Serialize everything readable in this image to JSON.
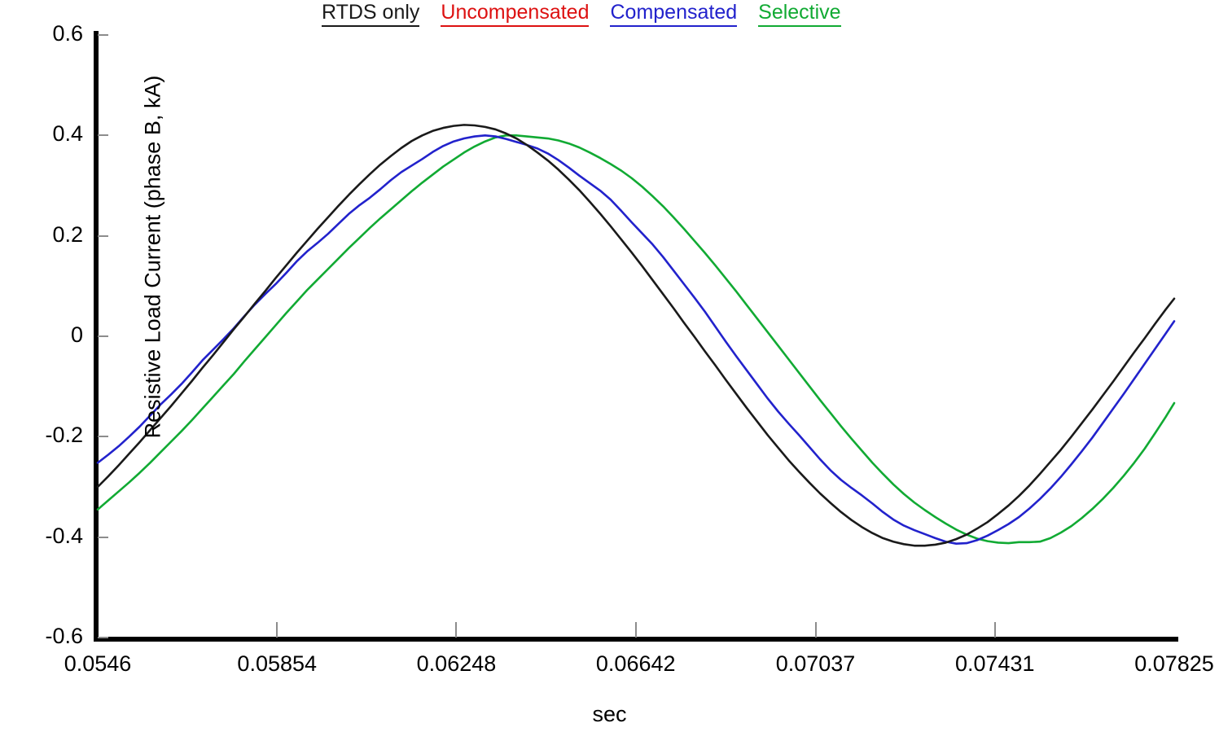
{
  "legend": {
    "entries": [
      {
        "label": "RTDS only",
        "color": "#1a1a1a"
      },
      {
        "label": "Uncompensated",
        "color": "#dd1111"
      },
      {
        "label": "Compensated",
        "color": "#2222cc"
      },
      {
        "label": "Selective",
        "color": "#11aa33"
      }
    ]
  },
  "chart_data": {
    "type": "line",
    "title": "",
    "xlabel": "sec",
    "ylabel": "Resistive Load Current (phase B, kA)",
    "xlim": [
      0.0546,
      0.07825
    ],
    "ylim": [
      -0.6,
      0.6
    ],
    "grid": false,
    "legend_position": "top",
    "xticks": [
      "0.0546",
      "0.05854",
      "0.06248",
      "0.06642",
      "0.07037",
      "0.07431",
      "0.07825"
    ],
    "xtick_values": [
      0.0546,
      0.05854,
      0.06248,
      0.06642,
      0.07037,
      0.07431,
      0.07825
    ],
    "yticks": [
      "0.6",
      "0.4",
      "0.2",
      "0",
      "-0.2",
      "-0.4",
      "-0.6"
    ],
    "ytick_values": [
      0.6,
      0.4,
      0.2,
      0,
      -0.2,
      -0.4,
      -0.6
    ],
    "series": [
      {
        "name": "RTDS only",
        "color": "#1a1a1a",
        "x": [
          0.0546,
          0.05483,
          0.05506,
          0.05529,
          0.05552,
          0.05575,
          0.05598,
          0.05621,
          0.05644,
          0.05667,
          0.0569,
          0.05713,
          0.05736,
          0.05759,
          0.05782,
          0.05805,
          0.05828,
          0.05851,
          0.05874,
          0.05897,
          0.0592,
          0.05943,
          0.05966,
          0.05989,
          0.06012,
          0.06035,
          0.06058,
          0.06081,
          0.06104,
          0.06127,
          0.0615,
          0.06173,
          0.06196,
          0.06219,
          0.06242,
          0.06265,
          0.06288,
          0.06311,
          0.06334,
          0.06357,
          0.0638,
          0.06403,
          0.06426,
          0.06449,
          0.06472,
          0.06495,
          0.06518,
          0.06541,
          0.06564,
          0.06587,
          0.0661,
          0.06633,
          0.06656,
          0.06679,
          0.06702,
          0.06725,
          0.06748,
          0.06771,
          0.06794,
          0.06817,
          0.0684,
          0.06863,
          0.06886,
          0.06909,
          0.06932,
          0.06955,
          0.06978,
          0.07001,
          0.07024,
          0.07047,
          0.0707,
          0.07093,
          0.07116,
          0.07139,
          0.07162,
          0.07185,
          0.07208,
          0.07231,
          0.07254,
          0.07277,
          0.073,
          0.07323,
          0.07346,
          0.07369,
          0.07392,
          0.07415,
          0.07438,
          0.07461,
          0.07484,
          0.07507,
          0.0753,
          0.07553,
          0.07576,
          0.07599,
          0.07622,
          0.07645,
          0.07668,
          0.07691,
          0.07714,
          0.07737,
          0.0776,
          0.07783,
          0.07806,
          0.07825
        ],
        "y": [
          -0.3,
          -0.279,
          -0.257,
          -0.234,
          -0.211,
          -0.187,
          -0.163,
          -0.139,
          -0.114,
          -0.089,
          -0.063,
          -0.038,
          -0.012,
          0.014,
          0.039,
          0.065,
          0.09,
          0.116,
          0.141,
          0.166,
          0.19,
          0.214,
          0.237,
          0.26,
          0.282,
          0.303,
          0.323,
          0.342,
          0.359,
          0.375,
          0.389,
          0.4,
          0.409,
          0.415,
          0.419,
          0.421,
          0.42,
          0.417,
          0.412,
          0.404,
          0.394,
          0.381,
          0.366,
          0.35,
          0.332,
          0.312,
          0.291,
          0.268,
          0.244,
          0.219,
          0.193,
          0.167,
          0.14,
          0.112,
          0.084,
          0.056,
          0.027,
          -0.001,
          -0.03,
          -0.058,
          -0.087,
          -0.115,
          -0.143,
          -0.17,
          -0.197,
          -0.222,
          -0.247,
          -0.27,
          -0.292,
          -0.313,
          -0.332,
          -0.35,
          -0.366,
          -0.38,
          -0.392,
          -0.402,
          -0.409,
          -0.414,
          -0.417,
          -0.417,
          -0.415,
          -0.411,
          -0.404,
          -0.395,
          -0.383,
          -0.37,
          -0.354,
          -0.337,
          -0.318,
          -0.297,
          -0.274,
          -0.25,
          -0.226,
          -0.2,
          -0.173,
          -0.146,
          -0.118,
          -0.09,
          -0.061,
          -0.032,
          -0.004,
          0.025,
          0.053,
          0.075
        ]
      },
      {
        "name": "Compensated",
        "color": "#2222cc",
        "x": [
          0.0546,
          0.05483,
          0.05506,
          0.05529,
          0.05552,
          0.05575,
          0.05598,
          0.05621,
          0.05644,
          0.05667,
          0.0569,
          0.05713,
          0.05736,
          0.05759,
          0.05782,
          0.05805,
          0.05828,
          0.05851,
          0.05874,
          0.05897,
          0.0592,
          0.05943,
          0.05966,
          0.05989,
          0.06012,
          0.06035,
          0.06058,
          0.06081,
          0.06104,
          0.06127,
          0.0615,
          0.06173,
          0.06196,
          0.06219,
          0.06242,
          0.06265,
          0.06288,
          0.06311,
          0.06334,
          0.06357,
          0.0638,
          0.06403,
          0.06426,
          0.06449,
          0.06472,
          0.06495,
          0.06518,
          0.06541,
          0.06564,
          0.06587,
          0.0661,
          0.06633,
          0.06656,
          0.06679,
          0.06702,
          0.06725,
          0.06748,
          0.06771,
          0.06794,
          0.06817,
          0.0684,
          0.06863,
          0.06886,
          0.06909,
          0.06932,
          0.06955,
          0.06978,
          0.07001,
          0.07024,
          0.07047,
          0.0707,
          0.07093,
          0.07116,
          0.07139,
          0.07162,
          0.07185,
          0.07208,
          0.07231,
          0.07254,
          0.07277,
          0.073,
          0.07323,
          0.07346,
          0.07369,
          0.07392,
          0.07415,
          0.07438,
          0.07461,
          0.07484,
          0.07507,
          0.0753,
          0.07553,
          0.07576,
          0.07599,
          0.07622,
          0.07645,
          0.07668,
          0.07691,
          0.07714,
          0.07737,
          0.0776,
          0.07783,
          0.07806,
          0.07825
        ],
        "y": [
          -0.252,
          -0.236,
          -0.219,
          -0.2,
          -0.18,
          -0.158,
          -0.136,
          -0.116,
          -0.095,
          -0.072,
          -0.048,
          -0.027,
          -0.006,
          0.016,
          0.04,
          0.063,
          0.084,
          0.104,
          0.126,
          0.149,
          0.169,
          0.186,
          0.204,
          0.224,
          0.244,
          0.261,
          0.276,
          0.293,
          0.311,
          0.327,
          0.34,
          0.353,
          0.367,
          0.379,
          0.388,
          0.394,
          0.398,
          0.4,
          0.398,
          0.393,
          0.387,
          0.381,
          0.374,
          0.364,
          0.351,
          0.336,
          0.32,
          0.305,
          0.29,
          0.272,
          0.25,
          0.227,
          0.205,
          0.183,
          0.158,
          0.131,
          0.104,
          0.077,
          0.049,
          0.019,
          -0.011,
          -0.04,
          -0.068,
          -0.096,
          -0.124,
          -0.15,
          -0.174,
          -0.197,
          -0.221,
          -0.245,
          -0.267,
          -0.286,
          -0.302,
          -0.317,
          -0.333,
          -0.35,
          -0.365,
          -0.377,
          -0.386,
          -0.394,
          -0.402,
          -0.409,
          -0.413,
          -0.412,
          -0.406,
          -0.397,
          -0.386,
          -0.374,
          -0.36,
          -0.343,
          -0.324,
          -0.303,
          -0.28,
          -0.255,
          -0.229,
          -0.202,
          -0.173,
          -0.144,
          -0.115,
          -0.085,
          -0.055,
          -0.025,
          0.005,
          0.03
        ]
      },
      {
        "name": "Selective",
        "color": "#11aa33",
        "x": [
          0.0546,
          0.05483,
          0.05506,
          0.05529,
          0.05552,
          0.05575,
          0.05598,
          0.05621,
          0.05644,
          0.05667,
          0.0569,
          0.05713,
          0.05736,
          0.05759,
          0.05782,
          0.05805,
          0.05828,
          0.05851,
          0.05874,
          0.05897,
          0.0592,
          0.05943,
          0.05966,
          0.05989,
          0.06012,
          0.06035,
          0.06058,
          0.06081,
          0.06104,
          0.06127,
          0.0615,
          0.06173,
          0.06196,
          0.06219,
          0.06242,
          0.06265,
          0.06288,
          0.06311,
          0.06334,
          0.06357,
          0.0638,
          0.06403,
          0.06426,
          0.06449,
          0.06472,
          0.06495,
          0.06518,
          0.06541,
          0.06564,
          0.06587,
          0.0661,
          0.06633,
          0.06656,
          0.06679,
          0.06702,
          0.06725,
          0.06748,
          0.06771,
          0.06794,
          0.06817,
          0.0684,
          0.06863,
          0.06886,
          0.06909,
          0.06932,
          0.06955,
          0.06978,
          0.07001,
          0.07024,
          0.07047,
          0.0707,
          0.07093,
          0.07116,
          0.07139,
          0.07162,
          0.07185,
          0.07208,
          0.07231,
          0.07254,
          0.07277,
          0.073,
          0.07323,
          0.07346,
          0.07369,
          0.07392,
          0.07415,
          0.07438,
          0.07461,
          0.07484,
          0.07507,
          0.0753,
          0.07553,
          0.07576,
          0.07599,
          0.07622,
          0.07645,
          0.07668,
          0.07691,
          0.07714,
          0.07737,
          0.0776,
          0.07783,
          0.07806,
          0.07825
        ],
        "y": [
          -0.345,
          -0.327,
          -0.309,
          -0.291,
          -0.272,
          -0.252,
          -0.231,
          -0.21,
          -0.189,
          -0.167,
          -0.144,
          -0.121,
          -0.098,
          -0.075,
          -0.05,
          -0.026,
          -0.002,
          0.022,
          0.046,
          0.069,
          0.092,
          0.113,
          0.134,
          0.155,
          0.176,
          0.196,
          0.216,
          0.235,
          0.253,
          0.271,
          0.289,
          0.306,
          0.322,
          0.338,
          0.352,
          0.366,
          0.378,
          0.388,
          0.396,
          0.4,
          0.4,
          0.398,
          0.396,
          0.394,
          0.39,
          0.384,
          0.376,
          0.366,
          0.355,
          0.343,
          0.33,
          0.315,
          0.298,
          0.279,
          0.259,
          0.237,
          0.214,
          0.19,
          0.166,
          0.141,
          0.115,
          0.089,
          0.062,
          0.035,
          0.008,
          -0.019,
          -0.046,
          -0.073,
          -0.1,
          -0.127,
          -0.153,
          -0.179,
          -0.204,
          -0.228,
          -0.252,
          -0.274,
          -0.295,
          -0.314,
          -0.331,
          -0.346,
          -0.36,
          -0.373,
          -0.385,
          -0.395,
          -0.403,
          -0.408,
          -0.411,
          -0.412,
          -0.41,
          -0.41,
          -0.409,
          -0.402,
          -0.391,
          -0.378,
          -0.362,
          -0.344,
          -0.324,
          -0.302,
          -0.278,
          -0.252,
          -0.224,
          -0.193,
          -0.161,
          -0.133
        ]
      }
    ]
  }
}
